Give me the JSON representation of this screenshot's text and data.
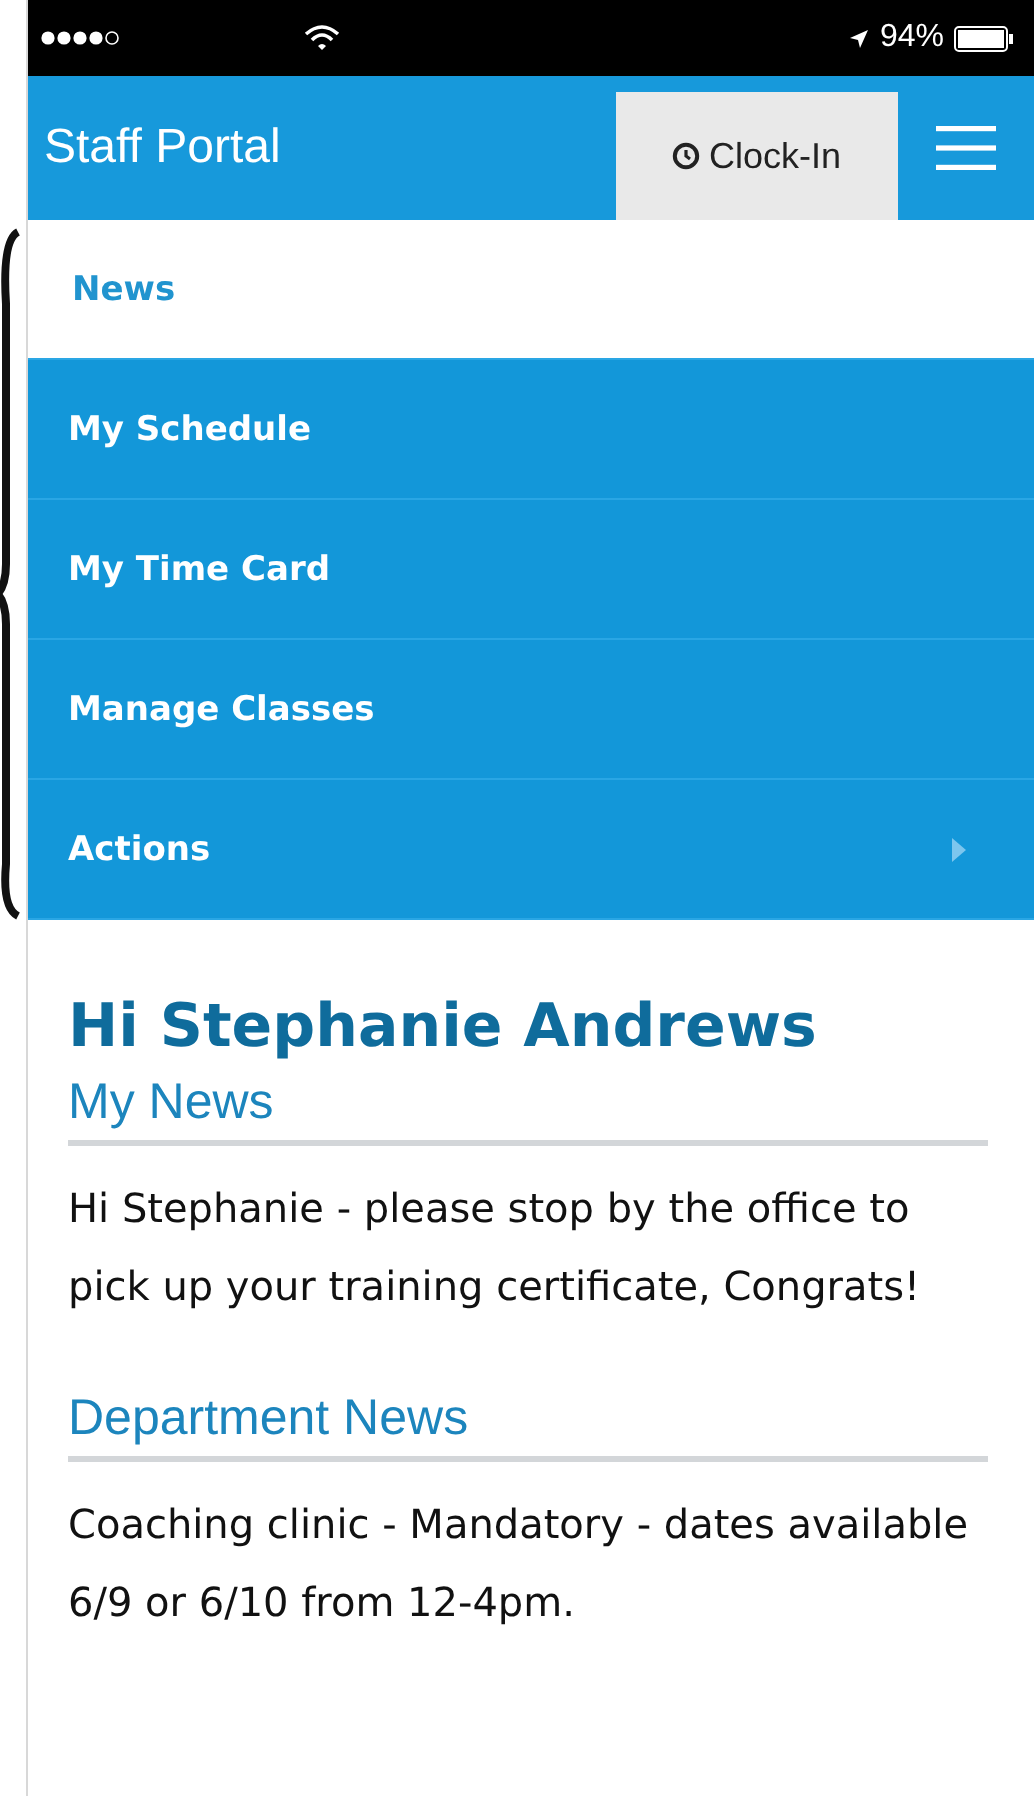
{
  "status_bar": {
    "battery": "94%"
  },
  "header": {
    "title": "Staff Portal",
    "clock_button": "Clock-In"
  },
  "menu": [
    {
      "label": "News",
      "selected": true,
      "submenu": false
    },
    {
      "label": "My Schedule",
      "selected": false,
      "submenu": false
    },
    {
      "label": "My Time Card",
      "selected": false,
      "submenu": false
    },
    {
      "label": "Manage Classes",
      "selected": false,
      "submenu": false
    },
    {
      "label": "Actions",
      "selected": false,
      "submenu": true
    }
  ],
  "greeting": "Hi Stephanie Andrews",
  "sections": [
    {
      "heading": "My News",
      "body": "Hi Stephanie - please stop by the office to pick up your training certificate, Congrats!"
    },
    {
      "heading": "Department News",
      "body": "Coaching clinic - Mandatory - dates available 6/9 or 6/10 from 12-4pm."
    }
  ]
}
